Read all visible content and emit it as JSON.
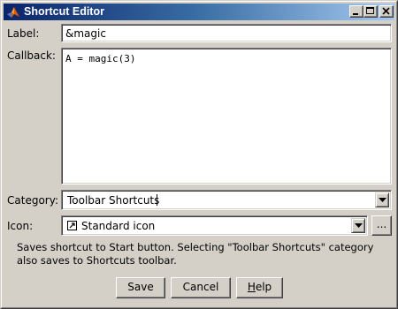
{
  "window": {
    "title": "Shortcut Editor",
    "icon": "matlab-logo-icon",
    "controls": {
      "minimize": "minimize-icon",
      "maximize": "maximize-icon",
      "close": "close-icon"
    }
  },
  "form": {
    "label_caption": "Label:",
    "label_value": "&magic",
    "callback_caption": "Callback:",
    "callback_value": "A = magic(3)",
    "category_caption": "Category:",
    "category_value": "Toolbar Shortcuts",
    "icon_caption": "Icon:",
    "icon_value": "Standard icon",
    "icon_browse_label": "...",
    "info_text": "Saves shortcut to Start button. Selecting \"Toolbar Shortcuts\" category also saves to Shortcuts toolbar."
  },
  "buttons": {
    "save": "Save",
    "cancel": "Cancel",
    "help_prefix": "H",
    "help_rest": "elp"
  }
}
